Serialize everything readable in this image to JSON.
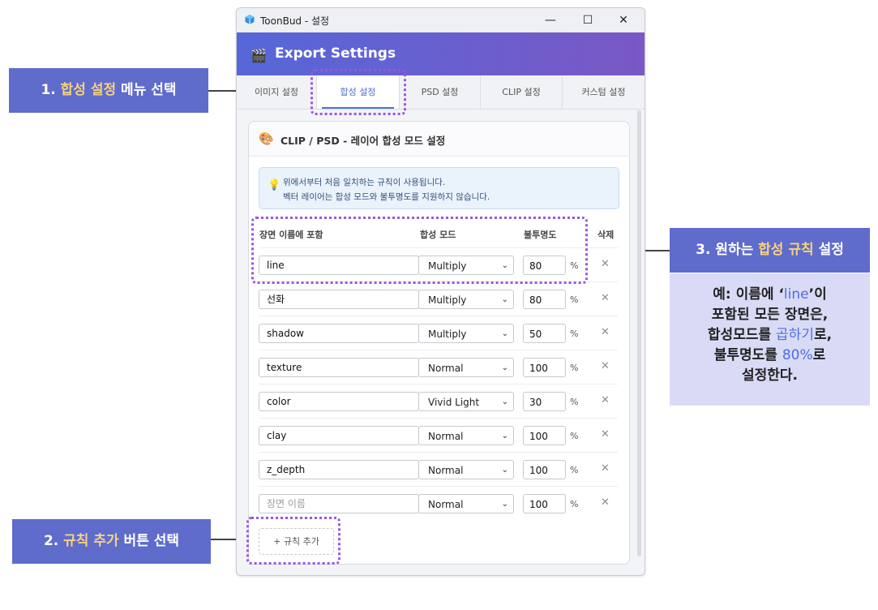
{
  "window": {
    "app_name": "ToonBud - 설정",
    "minimize_glyph": "—",
    "maximize_glyph": "☐",
    "close_glyph": "✕"
  },
  "header": {
    "icon": "🎬",
    "title": "Export Settings"
  },
  "tabs": [
    {
      "label": "이미지 설정",
      "active": false
    },
    {
      "label": "합성 설정",
      "active": true
    },
    {
      "label": "PSD 설정",
      "active": false
    },
    {
      "label": "CLIP 설정",
      "active": false
    },
    {
      "label": "커스텀 설정",
      "active": false
    }
  ],
  "card": {
    "icon": "🎨",
    "title": "CLIP / PSD - 레이어 합성 모드 설정",
    "info_icon": "💡",
    "info_line1": "위에서부터 처음 일치하는 규칙이 사용됩니다.",
    "info_line2": "벡터 레이어는 합성 모드와 불투명도를 지원하지 않습니다.",
    "columns": {
      "name": "장면 이름에 포함",
      "mode": "합성 모드",
      "opacity": "불투명도",
      "delete": "삭제"
    },
    "rows": [
      {
        "name": "line",
        "mode": "Multiply",
        "opacity": "80"
      },
      {
        "name": "선화",
        "mode": "Multiply",
        "opacity": "80"
      },
      {
        "name": "shadow",
        "mode": "Multiply",
        "opacity": "50"
      },
      {
        "name": "texture",
        "mode": "Normal",
        "opacity": "100"
      },
      {
        "name": "color",
        "mode": "Vivid Light",
        "opacity": "30"
      },
      {
        "name": "clay",
        "mode": "Normal",
        "opacity": "100"
      },
      {
        "name": "z_depth",
        "mode": "Normal",
        "opacity": "100"
      }
    ],
    "new_row": {
      "placeholder": "장면 이름",
      "mode": "Normal",
      "opacity": "100"
    },
    "percent_sign": "%",
    "delete_glyph": "✕",
    "add_button": "+ 규칙 추가"
  },
  "annotations": {
    "step1": {
      "prefix": "1. ",
      "highlight": "합성 설정",
      "suffix": " 메뉴 선택"
    },
    "step2": {
      "prefix": "2. ",
      "highlight": "규칙 추가",
      "suffix": " 버튼 선택"
    },
    "step3": {
      "prefix": "3. 원하는 ",
      "highlight": "합성 규칙",
      "suffix": " 설정"
    },
    "example": {
      "l1a": "예: 이름에 ‘",
      "l1b": "line",
      "l1c": "’이",
      "l2": "포함된 모든 장면은,",
      "l3a": "합성모드를 ",
      "l3b": "곱하기",
      "l3c": "로,",
      "l4a": "불투명도를 ",
      "l4b": "80%",
      "l4c": "로",
      "l5": "설정한다."
    }
  }
}
